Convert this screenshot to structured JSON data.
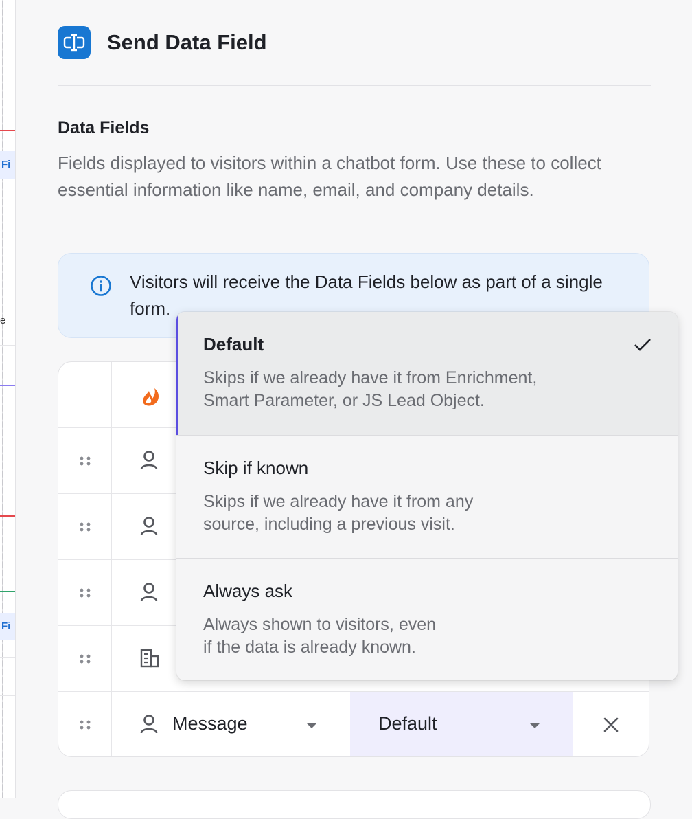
{
  "header": {
    "title": "Send Data Field",
    "icon": "input-field-icon",
    "icon_color": "#1877d2"
  },
  "section": {
    "title": "Data Fields",
    "description": "Fields displayed to visitors within a chatbot form. Use these to collect essential information like name, email, and company details."
  },
  "info": {
    "icon": "info-icon",
    "text": "Visitors will receive the Data Fields below as part of a single form."
  },
  "background": {
    "chip_text": "Fi",
    "letter": "e"
  },
  "table": {
    "header_icon": "flame-logo-icon",
    "rows": [
      {
        "icon": "person-icon",
        "name": "Message",
        "option": "Default"
      }
    ]
  },
  "dropdown": {
    "options": [
      {
        "title": "Default",
        "description_line1": "Skips if we already have it from Enrichment,",
        "description_line2": "Smart Parameter, or JS Lead Object.",
        "selected": true
      },
      {
        "title": "Skip if known",
        "description_line1": "Skips if we already have it from any",
        "description_line2": "source, including a previous visit.",
        "selected": false
      },
      {
        "title": "Always ask",
        "description_line1": "Always shown to visitors, even",
        "description_line2": "if the data is already known.",
        "selected": false
      }
    ],
    "accent_color": "#5b4ee0"
  }
}
